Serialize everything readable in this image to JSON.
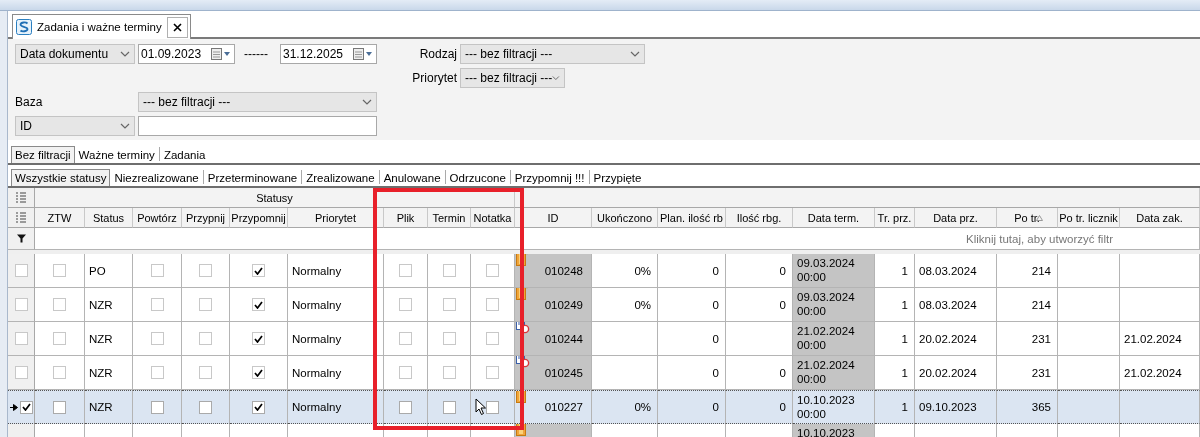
{
  "document_tab": {
    "title": "Zadania i ważne terminy"
  },
  "filters": {
    "date_field": {
      "value": "Data dokumentu"
    },
    "date_from": {
      "value": "01.09.2023"
    },
    "range_separator": "------",
    "date_to": {
      "value": "31.12.2025"
    },
    "rodzaj": {
      "label": "Rodzaj",
      "value": "--- bez filtracji ---"
    },
    "priorytet": {
      "label": "Priorytet",
      "value": "--- bez filtracji ---"
    },
    "baza": {
      "label": "Baza",
      "value": "--- bez filtracji ---"
    },
    "id_field": {
      "value": "ID"
    }
  },
  "group_tabs": [
    {
      "label": "Bez filtracji",
      "selected": true
    },
    {
      "label": "Ważne terminy",
      "selected": false
    },
    {
      "label": "Zadania",
      "selected": false
    }
  ],
  "status_tabs": [
    {
      "label": "Wszystkie statusy",
      "selected": true
    },
    {
      "label": "Niezrealizowane",
      "selected": false
    },
    {
      "label": "Przeterminowane",
      "selected": false
    },
    {
      "label": "Zrealizowane",
      "selected": false
    },
    {
      "label": "Anulowane",
      "selected": false
    },
    {
      "label": "Odrzucone",
      "selected": false
    },
    {
      "label": "Przypomnij !!!",
      "selected": false
    },
    {
      "label": "Przypięte",
      "selected": false
    }
  ],
  "grid": {
    "bands": [
      {
        "label": "Statusy",
        "columns": [
          {
            "label": "ZTW",
            "kind": "check"
          },
          {
            "label": "Status",
            "kind": "text"
          },
          {
            "label": "Powtórz",
            "kind": "check"
          },
          {
            "label": "Przypnij",
            "kind": "check"
          },
          {
            "label": "Przypomnij",
            "kind": "check"
          },
          {
            "label": "Priorytet",
            "kind": "text"
          },
          {
            "label": "Plik",
            "kind": "check",
            "highlighted": true
          },
          {
            "label": "Termin",
            "kind": "check",
            "highlighted": true
          },
          {
            "label": "Notatka",
            "kind": "check",
            "highlighted": true
          }
        ]
      },
      {
        "columns": [
          {
            "label": "ID",
            "kind": "id"
          },
          {
            "label": "Ukończono",
            "kind": "number"
          },
          {
            "label": "Plan. ilość rb",
            "kind": "number"
          },
          {
            "label": "Ilość rbg.",
            "kind": "number"
          },
          {
            "label": "Data term.",
            "kind": "date"
          },
          {
            "label": "Tr. prz.",
            "kind": "number"
          },
          {
            "label": "Data prz.",
            "kind": "text"
          },
          {
            "label": "Po tr.",
            "kind": "number",
            "sorted": true
          },
          {
            "label": "Po tr. licznik",
            "kind": "number"
          },
          {
            "label": "Data zak.",
            "kind": "text"
          }
        ]
      }
    ],
    "filter_hint": "Kliknij tutaj, aby utworzyć filtr",
    "rows": [
      {
        "checked": false,
        "selected": false,
        "cells": [
          {
            "checked": false
          },
          {
            "text": "PO"
          },
          {
            "checked": false
          },
          {
            "checked": false
          },
          {
            "checked": true
          },
          {
            "text": "Normalny"
          },
          {
            "checked": false
          },
          {
            "checked": false
          },
          {
            "checked": false
          },
          {
            "text": "010248",
            "kind": "note"
          },
          {
            "text": "0%"
          },
          {
            "text": "0"
          },
          {
            "text": "0"
          },
          {
            "text": "09.03.2024 00:00"
          },
          {
            "text": "1"
          },
          {
            "text": "08.03.2024"
          },
          {
            "text": "214"
          },
          {},
          {}
        ]
      },
      {
        "checked": false,
        "selected": false,
        "cells": [
          {
            "checked": false
          },
          {
            "text": "NZR"
          },
          {
            "checked": false
          },
          {
            "checked": false
          },
          {
            "checked": true
          },
          {
            "text": "Normalny"
          },
          {
            "checked": false
          },
          {
            "checked": false
          },
          {
            "checked": false
          },
          {
            "text": "010249",
            "kind": "note"
          },
          {
            "text": "0%"
          },
          {
            "text": "0"
          },
          {
            "text": "0"
          },
          {
            "text": "09.03.2024 00:00"
          },
          {
            "text": "1"
          },
          {
            "text": "08.03.2024"
          },
          {
            "text": "214"
          },
          {},
          {}
        ]
      },
      {
        "checked": false,
        "selected": false,
        "cells": [
          {
            "checked": false
          },
          {
            "text": "NZR"
          },
          {
            "checked": false
          },
          {
            "checked": false
          },
          {
            "checked": true
          },
          {
            "text": "Normalny"
          },
          {
            "checked": false
          },
          {
            "checked": false
          },
          {
            "checked": false
          },
          {
            "text": "010244",
            "kind": "reminder"
          },
          {},
          {
            "text": "0"
          },
          {},
          {
            "text": "21.02.2024 00:00"
          },
          {
            "text": "1"
          },
          {
            "text": "20.02.2024"
          },
          {
            "text": "231"
          },
          {},
          {
            "text": "21.02.2024"
          }
        ]
      },
      {
        "checked": false,
        "selected": false,
        "cells": [
          {
            "checked": false
          },
          {
            "text": "NZR"
          },
          {
            "checked": false
          },
          {
            "checked": false
          },
          {
            "checked": true
          },
          {
            "text": "Normalny"
          },
          {
            "checked": false
          },
          {
            "checked": false
          },
          {
            "checked": false
          },
          {
            "text": "010245",
            "kind": "reminder"
          },
          {},
          {
            "text": "0"
          },
          {
            "text": "0"
          },
          {
            "text": "21.02.2024 00:00"
          },
          {
            "text": "1"
          },
          {
            "text": "20.02.2024"
          },
          {
            "text": "231"
          },
          {},
          {
            "text": "21.02.2024"
          }
        ]
      },
      {
        "checked": true,
        "selected": true,
        "cells": [
          {
            "checked": false
          },
          {
            "text": "NZR"
          },
          {
            "checked": false
          },
          {
            "checked": false
          },
          {
            "checked": true
          },
          {
            "text": "Normalny"
          },
          {
            "checked": false
          },
          {
            "checked": false
          },
          {
            "checked": false
          },
          {
            "text": "010227",
            "kind": "note"
          },
          {
            "text": "0%"
          },
          {
            "text": "0"
          },
          {
            "text": "0"
          },
          {
            "text": "10.10.2023 00:00"
          },
          {
            "text": "1"
          },
          {
            "text": "09.10.2023"
          },
          {
            "text": "365"
          },
          {},
          {}
        ]
      },
      {
        "selected": false,
        "cells": [
          {},
          {},
          {},
          {},
          {},
          {},
          {},
          {},
          {},
          {
            "kind": "note"
          },
          {},
          {},
          {},
          {
            "text": "10.10.2023"
          },
          {},
          {},
          {},
          {},
          {}
        ]
      }
    ]
  }
}
